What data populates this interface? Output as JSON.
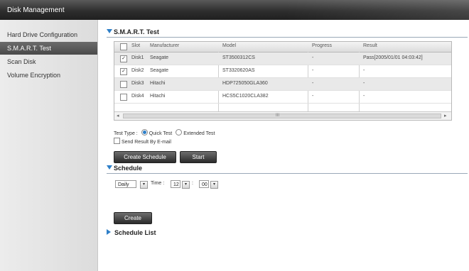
{
  "window": {
    "title": "Disk Management"
  },
  "sidebar": {
    "items": [
      {
        "label": "Hard Drive Configuration"
      },
      {
        "label": "S.M.A.R.T. Test"
      },
      {
        "label": "Scan Disk"
      },
      {
        "label": "Volume Encryption"
      }
    ]
  },
  "smart": {
    "title": "S.M.A.R.T. Test",
    "columns": [
      "Slot",
      "Manufacturer",
      "Model",
      "Progress",
      "Result"
    ],
    "rows": [
      {
        "slot": "Disk1",
        "manufacturer": "Seagate",
        "model": "ST3500312CS",
        "progress": "-",
        "result": "Pass[2005/01/01 04:03:42]",
        "checked": "✓"
      },
      {
        "slot": "Disk2",
        "manufacturer": "Seagate",
        "model": "ST3320620AS",
        "progress": "-",
        "result": "-",
        "checked": "✓"
      },
      {
        "slot": "Disk3",
        "manufacturer": "Hitachi",
        "model": "HDP725050GLA360",
        "progress": "-",
        "result": "-",
        "checked": ""
      },
      {
        "slot": "Disk4",
        "manufacturer": "Hitachi",
        "model": "HCS5C1020CLA382",
        "progress": "-",
        "result": "-",
        "checked": ""
      }
    ],
    "scroll_left": "◂",
    "scroll_mid": "III",
    "scroll_right": "▸",
    "test_type_label": "Test Type :",
    "quick_test": "Quick Test",
    "extended_test": "Extended Test",
    "selected_test": "quick",
    "send_result": "Send Result By E-mail",
    "create_schedule_button": "Create Schedule",
    "start_button": "Start"
  },
  "schedule": {
    "title": "Schedule",
    "frequency": "Daily",
    "time_label": "Time :",
    "hour": "12",
    "colon": ":",
    "minute": "00",
    "create_button": "Create"
  },
  "schedule_list": {
    "title": "Schedule List"
  },
  "colors": {
    "accent": "#2e7fc8",
    "titlebar": "#2e2e2e",
    "sidebar_active": "#555555"
  }
}
